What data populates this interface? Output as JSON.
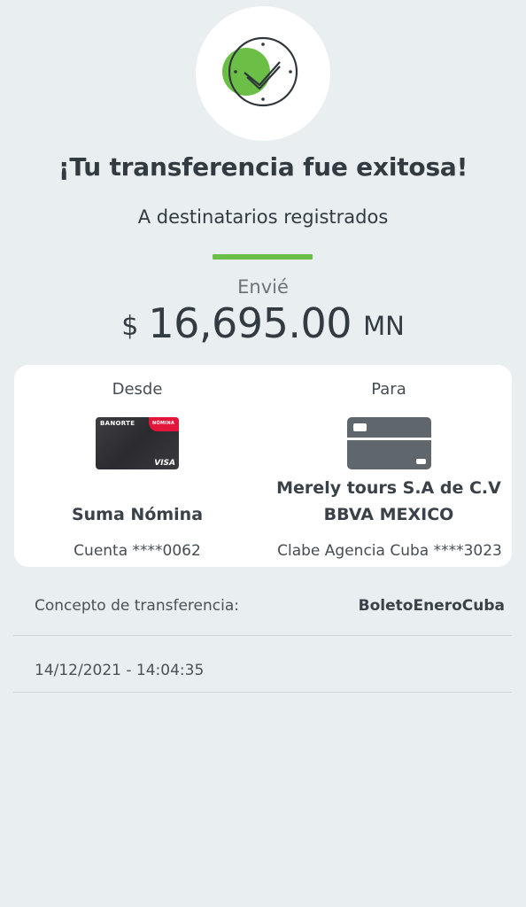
{
  "success": {
    "icon": "clock-check-icon",
    "title": "¡Tu transferencia fue exitosa!",
    "subtitle": "A destinatarios registrados"
  },
  "amount": {
    "label": "Envié",
    "currency_symbol": "$",
    "value": "16,695.00",
    "unit": "MN"
  },
  "from": {
    "label": "Desde",
    "card_icon": "banorte-visa-card-icon",
    "card_brand": "BANORTE",
    "card_badge": "NÓMINA",
    "card_network": "VISA",
    "account_name": "Suma Nómina",
    "account_number": "Cuenta ****0062"
  },
  "to": {
    "label": "Para",
    "card_icon": "generic-card-icon",
    "beneficiary": "Merely tours S.A de C.V",
    "bank": "BBVA MEXICO",
    "account_number": "Clabe Agencia Cuba ****3023"
  },
  "details": {
    "concept_label": "Concepto de transferencia:",
    "concept_value": "BoletoEneroCuba",
    "timestamp": "14/12/2021 - 14:04:35"
  },
  "colors": {
    "background": "#e9eef0",
    "accent_green": "#6cbf46",
    "card_red": "#e2153a",
    "generic_card": "#5f676d"
  }
}
